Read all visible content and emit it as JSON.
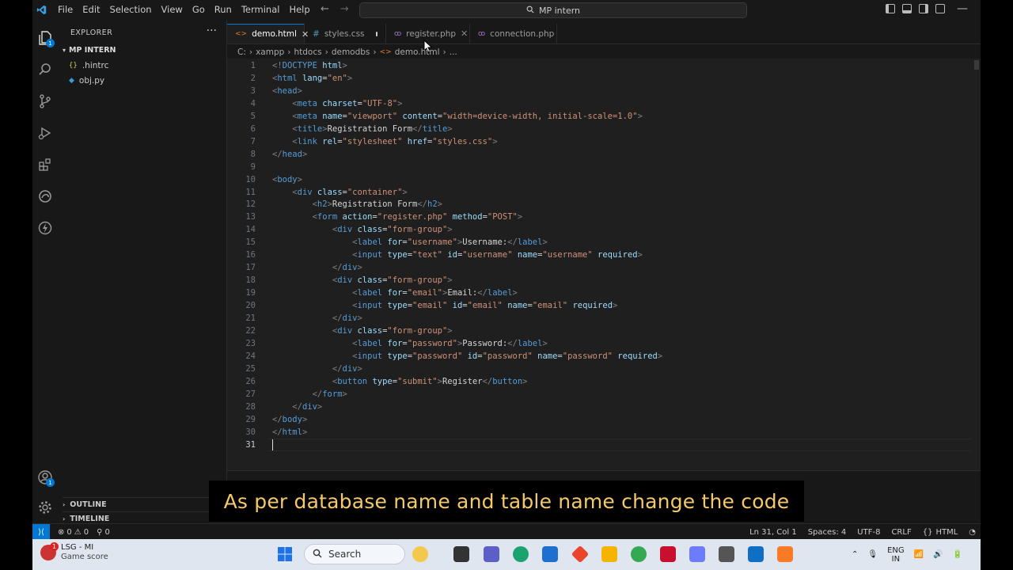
{
  "window": {
    "menu": [
      "File",
      "Edit",
      "Selection",
      "View",
      "Go",
      "Run",
      "Terminal",
      "Help"
    ],
    "search_text": "MP intern"
  },
  "activity_bar": {
    "icons": [
      "explorer-icon",
      "search-icon",
      "source-control-icon",
      "run-debug-icon",
      "extensions-icon",
      "edge-icon",
      "lightning-icon"
    ],
    "explorer_badge": "1",
    "account_badge": "1"
  },
  "sidebar": {
    "title": "EXPLORER",
    "folder": "MP INTERN",
    "files": [
      {
        "icon": "{}",
        "name": ".hintrc",
        "color": "#cbcb41"
      },
      {
        "icon": "◆",
        "name": "obj.py",
        "color": "#3c9bd8"
      }
    ],
    "outline": "OUTLINE",
    "timeline": "TIMELINE"
  },
  "tabs": [
    {
      "name": "demo.html",
      "icon": "<>",
      "icon_color": "#e37933",
      "active": true,
      "close": "✕"
    },
    {
      "name": "styles.css",
      "icon": "#",
      "icon_color": "#519aba",
      "modified": true
    },
    {
      "name": "register.php",
      "icon": "php",
      "icon_color": "#a074c4",
      "close": "✕"
    },
    {
      "name": "connection.php",
      "icon": "php",
      "icon_color": "#a074c4"
    }
  ],
  "breadcrumb": [
    "C:",
    "xampp",
    "htdocs",
    "demodbs",
    "demo.html",
    "..."
  ],
  "code": {
    "lines": [
      [
        [
          "br",
          "<!"
        ],
        [
          "tag",
          "DOCTYPE"
        ],
        [
          "tx",
          " "
        ],
        [
          "at",
          "html"
        ],
        [
          "br",
          ">"
        ]
      ],
      [
        [
          "br",
          "<"
        ],
        [
          "tag",
          "html"
        ],
        [
          "tx",
          " "
        ],
        [
          "at",
          "lang"
        ],
        [
          "tx",
          "="
        ],
        [
          "st",
          "\"en\""
        ],
        [
          "br",
          ">"
        ]
      ],
      [
        [
          "br",
          "<"
        ],
        [
          "tag",
          "head"
        ],
        [
          "br",
          ">"
        ]
      ],
      [
        [
          "tx",
          "    "
        ],
        [
          "br",
          "<"
        ],
        [
          "tag",
          "meta"
        ],
        [
          "tx",
          " "
        ],
        [
          "at",
          "charset"
        ],
        [
          "tx",
          "="
        ],
        [
          "st",
          "\"UTF-8\""
        ],
        [
          "br",
          ">"
        ]
      ],
      [
        [
          "tx",
          "    "
        ],
        [
          "br",
          "<"
        ],
        [
          "tag",
          "meta"
        ],
        [
          "tx",
          " "
        ],
        [
          "at",
          "name"
        ],
        [
          "tx",
          "="
        ],
        [
          "st",
          "\"viewport\""
        ],
        [
          "tx",
          " "
        ],
        [
          "at",
          "content"
        ],
        [
          "tx",
          "="
        ],
        [
          "st",
          "\"width=device-width, initial-scale=1.0\""
        ],
        [
          "br",
          ">"
        ]
      ],
      [
        [
          "tx",
          "    "
        ],
        [
          "br",
          "<"
        ],
        [
          "tag",
          "title"
        ],
        [
          "br",
          ">"
        ],
        [
          "tx",
          "Registration Form"
        ],
        [
          "br",
          "</"
        ],
        [
          "tag",
          "title"
        ],
        [
          "br",
          ">"
        ]
      ],
      [
        [
          "tx",
          "    "
        ],
        [
          "br",
          "<"
        ],
        [
          "tag",
          "link"
        ],
        [
          "tx",
          " "
        ],
        [
          "at",
          "rel"
        ],
        [
          "tx",
          "="
        ],
        [
          "st",
          "\"stylesheet\""
        ],
        [
          "tx",
          " "
        ],
        [
          "at",
          "href"
        ],
        [
          "tx",
          "="
        ],
        [
          "st",
          "\"styles.css\""
        ],
        [
          "br",
          ">"
        ]
      ],
      [
        [
          "br",
          "</"
        ],
        [
          "tag",
          "head"
        ],
        [
          "br",
          ">"
        ]
      ],
      [],
      [
        [
          "br",
          "<"
        ],
        [
          "tag",
          "body"
        ],
        [
          "br",
          ">"
        ]
      ],
      [
        [
          "tx",
          "    "
        ],
        [
          "br",
          "<"
        ],
        [
          "tag",
          "div"
        ],
        [
          "tx",
          " "
        ],
        [
          "at",
          "class"
        ],
        [
          "tx",
          "="
        ],
        [
          "st",
          "\"container\""
        ],
        [
          "br",
          ">"
        ]
      ],
      [
        [
          "tx",
          "        "
        ],
        [
          "br",
          "<"
        ],
        [
          "tag",
          "h2"
        ],
        [
          "br",
          ">"
        ],
        [
          "tx",
          "Registration Form"
        ],
        [
          "br",
          "</"
        ],
        [
          "tag",
          "h2"
        ],
        [
          "br",
          ">"
        ]
      ],
      [
        [
          "tx",
          "        "
        ],
        [
          "br",
          "<"
        ],
        [
          "tag",
          "form"
        ],
        [
          "tx",
          " "
        ],
        [
          "at",
          "action"
        ],
        [
          "tx",
          "="
        ],
        [
          "st",
          "\"register.php\""
        ],
        [
          "tx",
          " "
        ],
        [
          "at",
          "method"
        ],
        [
          "tx",
          "="
        ],
        [
          "st",
          "\"POST\""
        ],
        [
          "br",
          ">"
        ]
      ],
      [
        [
          "tx",
          "            "
        ],
        [
          "br",
          "<"
        ],
        [
          "tag",
          "div"
        ],
        [
          "tx",
          " "
        ],
        [
          "at",
          "class"
        ],
        [
          "tx",
          "="
        ],
        [
          "st",
          "\"form-group\""
        ],
        [
          "br",
          ">"
        ]
      ],
      [
        [
          "tx",
          "                "
        ],
        [
          "br",
          "<"
        ],
        [
          "tag",
          "label"
        ],
        [
          "tx",
          " "
        ],
        [
          "at",
          "for"
        ],
        [
          "tx",
          "="
        ],
        [
          "st",
          "\"username\""
        ],
        [
          "br",
          ">"
        ],
        [
          "tx",
          "Username:"
        ],
        [
          "br",
          "</"
        ],
        [
          "tag",
          "label"
        ],
        [
          "br",
          ">"
        ]
      ],
      [
        [
          "tx",
          "                "
        ],
        [
          "br",
          "<"
        ],
        [
          "tag",
          "input"
        ],
        [
          "tx",
          " "
        ],
        [
          "at",
          "type"
        ],
        [
          "tx",
          "="
        ],
        [
          "st",
          "\"text\""
        ],
        [
          "tx",
          " "
        ],
        [
          "at",
          "id"
        ],
        [
          "tx",
          "="
        ],
        [
          "st",
          "\"username\""
        ],
        [
          "tx",
          " "
        ],
        [
          "at",
          "name"
        ],
        [
          "tx",
          "="
        ],
        [
          "st",
          "\"username\""
        ],
        [
          "tx",
          " "
        ],
        [
          "at",
          "required"
        ],
        [
          "br",
          ">"
        ]
      ],
      [
        [
          "tx",
          "            "
        ],
        [
          "br",
          "</"
        ],
        [
          "tag",
          "div"
        ],
        [
          "br",
          ">"
        ]
      ],
      [
        [
          "tx",
          "            "
        ],
        [
          "br",
          "<"
        ],
        [
          "tag",
          "div"
        ],
        [
          "tx",
          " "
        ],
        [
          "at",
          "class"
        ],
        [
          "tx",
          "="
        ],
        [
          "st",
          "\"form-group\""
        ],
        [
          "br",
          ">"
        ]
      ],
      [
        [
          "tx",
          "                "
        ],
        [
          "br",
          "<"
        ],
        [
          "tag",
          "label"
        ],
        [
          "tx",
          " "
        ],
        [
          "at",
          "for"
        ],
        [
          "tx",
          "="
        ],
        [
          "st",
          "\"email\""
        ],
        [
          "br",
          ">"
        ],
        [
          "tx",
          "Email:"
        ],
        [
          "br",
          "</"
        ],
        [
          "tag",
          "label"
        ],
        [
          "br",
          ">"
        ]
      ],
      [
        [
          "tx",
          "                "
        ],
        [
          "br",
          "<"
        ],
        [
          "tag",
          "input"
        ],
        [
          "tx",
          " "
        ],
        [
          "at",
          "type"
        ],
        [
          "tx",
          "="
        ],
        [
          "st",
          "\"email\""
        ],
        [
          "tx",
          " "
        ],
        [
          "at",
          "id"
        ],
        [
          "tx",
          "="
        ],
        [
          "st",
          "\"email\""
        ],
        [
          "tx",
          " "
        ],
        [
          "at",
          "name"
        ],
        [
          "tx",
          "="
        ],
        [
          "st",
          "\"email\""
        ],
        [
          "tx",
          " "
        ],
        [
          "at",
          "required"
        ],
        [
          "br",
          ">"
        ]
      ],
      [
        [
          "tx",
          "            "
        ],
        [
          "br",
          "</"
        ],
        [
          "tag",
          "div"
        ],
        [
          "br",
          ">"
        ]
      ],
      [
        [
          "tx",
          "            "
        ],
        [
          "br",
          "<"
        ],
        [
          "tag",
          "div"
        ],
        [
          "tx",
          " "
        ],
        [
          "at",
          "class"
        ],
        [
          "tx",
          "="
        ],
        [
          "st",
          "\"form-group\""
        ],
        [
          "br",
          ">"
        ]
      ],
      [
        [
          "tx",
          "                "
        ],
        [
          "br",
          "<"
        ],
        [
          "tag",
          "label"
        ],
        [
          "tx",
          " "
        ],
        [
          "at",
          "for"
        ],
        [
          "tx",
          "="
        ],
        [
          "st",
          "\"password\""
        ],
        [
          "br",
          ">"
        ],
        [
          "tx",
          "Password:"
        ],
        [
          "br",
          "</"
        ],
        [
          "tag",
          "label"
        ],
        [
          "br",
          ">"
        ]
      ],
      [
        [
          "tx",
          "                "
        ],
        [
          "br",
          "<"
        ],
        [
          "tag",
          "input"
        ],
        [
          "tx",
          " "
        ],
        [
          "at",
          "type"
        ],
        [
          "tx",
          "="
        ],
        [
          "st",
          "\"password\""
        ],
        [
          "tx",
          " "
        ],
        [
          "at",
          "id"
        ],
        [
          "tx",
          "="
        ],
        [
          "st",
          "\"password\""
        ],
        [
          "tx",
          " "
        ],
        [
          "at",
          "name"
        ],
        [
          "tx",
          "="
        ],
        [
          "st",
          "\"password\""
        ],
        [
          "tx",
          " "
        ],
        [
          "at",
          "required"
        ],
        [
          "br",
          ">"
        ]
      ],
      [
        [
          "tx",
          "            "
        ],
        [
          "br",
          "</"
        ],
        [
          "tag",
          "div"
        ],
        [
          "br",
          ">"
        ]
      ],
      [
        [
          "tx",
          "            "
        ],
        [
          "br",
          "<"
        ],
        [
          "tag",
          "button"
        ],
        [
          "tx",
          " "
        ],
        [
          "at",
          "type"
        ],
        [
          "tx",
          "="
        ],
        [
          "st",
          "\"submit\""
        ],
        [
          "br",
          ">"
        ],
        [
          "tx",
          "Register"
        ],
        [
          "br",
          "</"
        ],
        [
          "tag",
          "button"
        ],
        [
          "br",
          ">"
        ]
      ],
      [
        [
          "tx",
          "        "
        ],
        [
          "br",
          "</"
        ],
        [
          "tag",
          "form"
        ],
        [
          "br",
          ">"
        ]
      ],
      [
        [
          "tx",
          "    "
        ],
        [
          "br",
          "</"
        ],
        [
          "tag",
          "div"
        ],
        [
          "br",
          ">"
        ]
      ],
      [
        [
          "br",
          "</"
        ],
        [
          "tag",
          "body"
        ],
        [
          "br",
          ">"
        ]
      ],
      [
        [
          "br",
          "</"
        ],
        [
          "tag",
          "html"
        ],
        [
          "br",
          ">"
        ]
      ],
      []
    ],
    "current_line": 31
  },
  "subtitle": "As per database name and table name change the code",
  "statusbar": {
    "remote": "⟩⟨",
    "errors": "0",
    "warnings": "0",
    "ports": "0",
    "position": "Ln 31, Col 1",
    "spaces": "Spaces: 4",
    "encoding": "UTF-8",
    "eol": "CRLF",
    "language": "HTML"
  },
  "taskbar": {
    "widget_title": "LSG - MI",
    "widget_sub": "Game score",
    "widget_badge": "1",
    "search_label": "Search",
    "lang_top": "ENG",
    "lang_bottom": "IN"
  },
  "colors": {
    "accent": "#0078d4",
    "subtitle": "#f5c96b",
    "tag": "#569cd6",
    "attr": "#9cdcfe",
    "string": "#ce9178"
  }
}
